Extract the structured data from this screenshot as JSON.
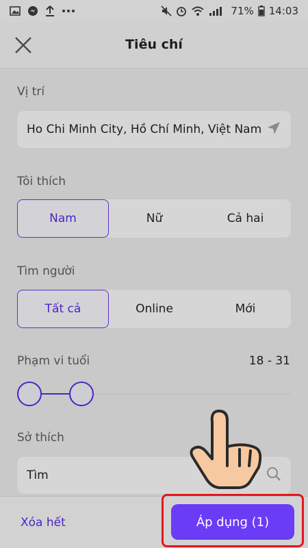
{
  "status_bar": {
    "battery": "71%",
    "time": "14:03",
    "icons": [
      "gallery-icon",
      "messenger-icon",
      "upload-icon",
      "more-icon",
      "mute-icon",
      "alarm-icon",
      "wifi-icon",
      "signal-icon",
      "battery-icon"
    ]
  },
  "header": {
    "title": "Tiêu chí",
    "close_icon": "close-icon"
  },
  "location": {
    "label": "Vị trí",
    "value": "Ho Chi Minh City, Hồ Chí Minh, Việt Nam",
    "icon": "navigation-arrow-icon"
  },
  "preference": {
    "label": "Tôi thích",
    "options": [
      "Nam",
      "Nữ",
      "Cả hai"
    ],
    "selected": "Nam"
  },
  "find_people": {
    "label": "Tìm người",
    "options": [
      "Tất cả",
      "Online",
      "Mới"
    ],
    "selected": "Tất cả"
  },
  "age_range": {
    "label": "Phạm vi tuổi",
    "value": "18 - 31"
  },
  "hobbies": {
    "label": "Sở thích",
    "value": "Tìm",
    "icon": "search-icon"
  },
  "footer": {
    "clear_label": "Xóa hết",
    "apply_label": "Áp dụng (1)"
  },
  "colors": {
    "accent": "#4a25c2",
    "apply_button": "#6a3cf5",
    "highlight_frame": "#e3161b"
  }
}
